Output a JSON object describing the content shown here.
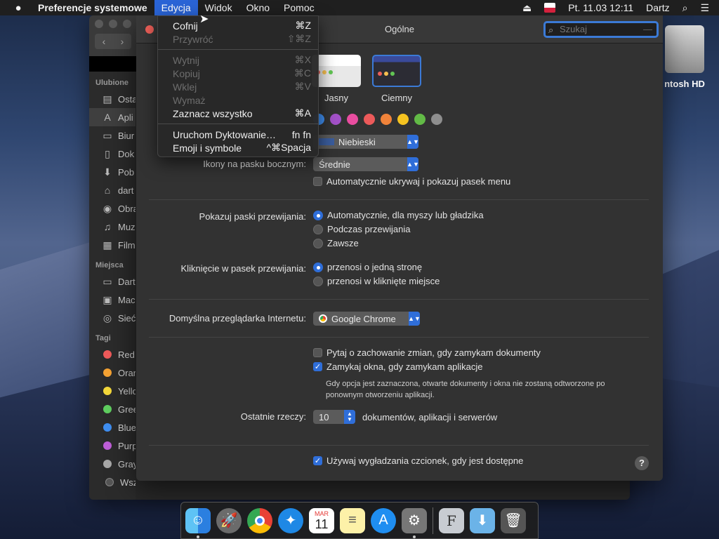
{
  "menubar": {
    "app": "Preferencje systemowe",
    "items": [
      "Edycja",
      "Widok",
      "Okno",
      "Pomoc"
    ],
    "datetime": "Pt. 11.03  12:11",
    "user": "Dartz"
  },
  "edit_menu": {
    "undo": {
      "label": "Cofnij",
      "shortcut": "⌘Z"
    },
    "redo": {
      "label": "Przywróć",
      "shortcut": "⇧⌘Z"
    },
    "cut": {
      "label": "Wytnij",
      "shortcut": "⌘X"
    },
    "copy": {
      "label": "Kopiuj",
      "shortcut": "⌘C"
    },
    "paste": {
      "label": "Wklej",
      "shortcut": "⌘V"
    },
    "delete": {
      "label": "Wymaż"
    },
    "select_all": {
      "label": "Zaznacz wszystko",
      "shortcut": "⌘A"
    },
    "dictation": {
      "label": "Uruchom Dyktowanie…",
      "shortcut": "fn fn"
    },
    "emoji": {
      "label": "Emoji i symbole",
      "shortcut": "^⌘Spacja"
    }
  },
  "finder": {
    "favorites_header": "Ulubione",
    "favorites": [
      "Osta",
      "Apli",
      "Biur",
      "Dok",
      "Pob",
      "dart",
      "Obra",
      "Muz",
      "Film"
    ],
    "places_header": "Miejsca",
    "places": [
      "Dart",
      "Mac",
      "Sieć"
    ],
    "tags_header": "Tagi",
    "tags": [
      {
        "label": "Red",
        "color": "#ee5a5a"
      },
      {
        "label": "Oran",
        "color": "#f5a233"
      },
      {
        "label": "Yello",
        "color": "#f4d83a"
      },
      {
        "label": "Gree",
        "color": "#5fce5f"
      },
      {
        "label": "Blue",
        "color": "#3f8ef0"
      },
      {
        "label": "Purp",
        "color": "#bf5fd8"
      },
      {
        "label": "Gray",
        "color": "#a8a8a8"
      }
    ],
    "all_tags": "Wszystkie ta..."
  },
  "desktop": {
    "drive_label": "ntosh HD"
  },
  "prefs": {
    "title": "Ogólne",
    "search_placeholder": "Szukaj",
    "appearance": {
      "light": "Jasny",
      "dark": "Ciemny"
    },
    "accent_colors": [
      "#3f8ef0",
      "#a351c8",
      "#e94da0",
      "#ec5a5a",
      "#f0833a",
      "#f5c320",
      "#62ba46",
      "#8e8e8e"
    ],
    "highlight_value": "Niebieski",
    "sidebar_icons_label": "Ikony na pasku bocznym:",
    "sidebar_icons_value": "Średnie",
    "autohide_menu": "Automatycznie ukrywaj i pokazuj pasek menu",
    "scrollbars_label": "Pokazuj paski przewijania:",
    "scrollbars_options": [
      "Automatycznie, dla myszy lub gładzika",
      "Podczas przewijania",
      "Zawsze"
    ],
    "click_label": "Kliknięcie w pasek przewijania:",
    "click_options": [
      "przenosi o jedną stronę",
      "przenosi w kliknięte miejsce"
    ],
    "browser_label": "Domyślna przeglądarka Internetu:",
    "browser_value": "Google Chrome",
    "ask_save": "Pytaj o zachowanie zmian, gdy zamykam dokumenty",
    "close_windows": "Zamykaj okna, gdy zamykam aplikacje",
    "close_windows_note": "Gdy opcja jest zaznaczona, otwarte dokumenty i okna nie zostaną odtworzone po ponownym otworzeniu aplikacji.",
    "recent_label": "Ostatnie rzeczy:",
    "recent_value": "10",
    "recent_suffix": "dokumentów, aplikacji i serwerów",
    "smoothing": "Używaj wygładzania czcionek, gdy jest dostępne",
    "help": "?"
  },
  "dock": {
    "calendar_month": "MAR",
    "calendar_day": "11"
  }
}
